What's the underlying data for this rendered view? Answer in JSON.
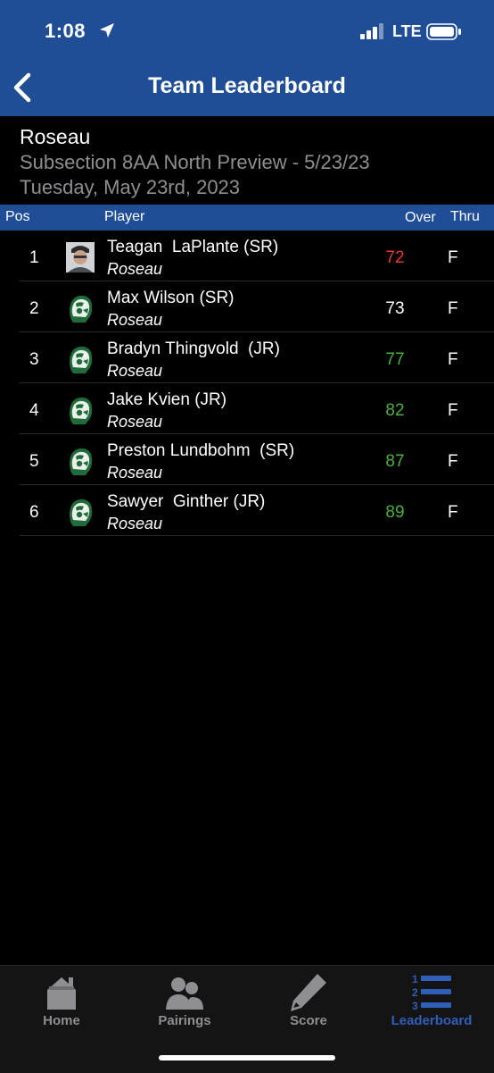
{
  "status_bar": {
    "time": "1:08",
    "network": "LTE"
  },
  "nav": {
    "title": "Team Leaderboard",
    "back_icon": "chevron-left-icon"
  },
  "team": {
    "name": "Roseau",
    "event": "Subsection 8AA North Preview - 5/23/23",
    "date": "Tuesday, May 23rd, 2023"
  },
  "table": {
    "headers": {
      "pos": "Pos",
      "player": "Player",
      "over": "Over",
      "thru": "Thru"
    },
    "rows": [
      {
        "pos": "1",
        "name": "Teagan  LaPlante (SR)",
        "team": "Roseau",
        "score": "72",
        "thru": "F",
        "score_color": "#e53935",
        "avatar": "photo"
      },
      {
        "pos": "2",
        "name": "Max Wilson (SR)",
        "team": "Roseau",
        "score": "73",
        "thru": "F",
        "score_color": "#ffffff",
        "avatar": "logo"
      },
      {
        "pos": "3",
        "name": "Bradyn Thingvold  (JR)",
        "team": "Roseau",
        "score": "77",
        "thru": "F",
        "score_color": "#4caf3e",
        "avatar": "logo"
      },
      {
        "pos": "4",
        "name": "Jake Kvien (JR)",
        "team": "Roseau",
        "score": "82",
        "thru": "F",
        "score_color": "#4caf3e",
        "avatar": "logo"
      },
      {
        "pos": "5",
        "name": "Preston Lundbohm  (SR)",
        "team": "Roseau",
        "score": "87",
        "thru": "F",
        "score_color": "#4caf3e",
        "avatar": "logo"
      },
      {
        "pos": "6",
        "name": "Sawyer  Ginther (JR)",
        "team": "Roseau",
        "score": "89",
        "thru": "F",
        "score_color": "#4caf3e",
        "avatar": "logo"
      }
    ]
  },
  "tabs": [
    {
      "label": "Home",
      "icon": "home-icon",
      "active": false
    },
    {
      "label": "Pairings",
      "icon": "people-icon",
      "active": false
    },
    {
      "label": "Score",
      "icon": "pencil-icon",
      "active": false
    },
    {
      "label": "Leaderboard",
      "icon": "leaderboard-icon",
      "active": true
    }
  ],
  "colors": {
    "header_blue": "#1f4e96",
    "active_tab": "#2f5fb8",
    "over_par": "#4caf3e",
    "under_par": "#e53935"
  }
}
